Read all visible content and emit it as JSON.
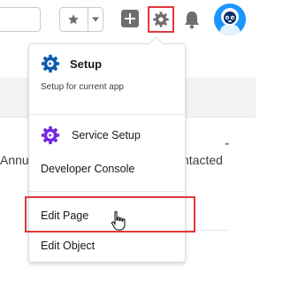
{
  "background": {
    "left_text": "Annu",
    "right_text": "ntacted",
    "dash": "-"
  },
  "header": {
    "icons": [
      "star-icon",
      "chevron-down-icon",
      "plus-icon",
      "gear-icon",
      "bell-icon",
      "avatar"
    ]
  },
  "setup_menu": {
    "header": {
      "title": "Setup",
      "subtitle": "Setup for current app",
      "icon": "setup-gear-icon"
    },
    "items": [
      {
        "label": "Service Setup",
        "icon": "service-setup-icon"
      },
      {
        "label": "Developer Console"
      },
      {
        "label": "Edit Page",
        "highlighted": true
      },
      {
        "label": "Edit Object"
      }
    ]
  },
  "colors": {
    "highlight_border": "#e23838",
    "setup_icon": "#0b5cab",
    "service_icon": "#7526e3",
    "avatar": "#1b96ff"
  }
}
